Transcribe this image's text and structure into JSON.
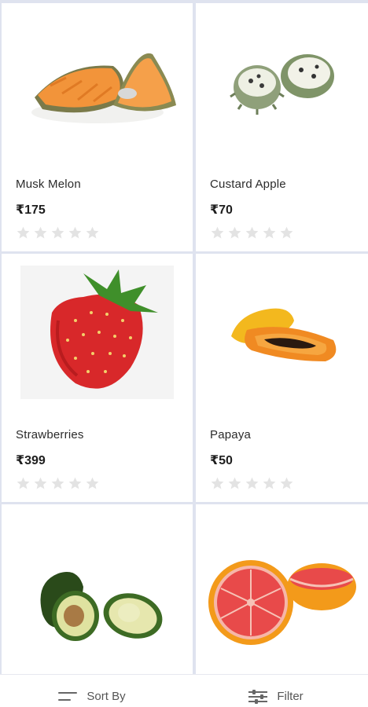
{
  "products": [
    {
      "name": "Musk Melon",
      "price": "₹175",
      "rating": 0,
      "image": "musk-melon"
    },
    {
      "name": "Custard Apple",
      "price": "₹70",
      "rating": 0,
      "image": "custard-apple"
    },
    {
      "name": "Strawberries",
      "price": "₹399",
      "rating": 0,
      "image": "strawberry"
    },
    {
      "name": "Papaya",
      "price": "₹50",
      "rating": 0,
      "image": "papaya"
    },
    {
      "name": "",
      "price": "",
      "rating": 0,
      "image": "avocado"
    },
    {
      "name": "",
      "price": "",
      "rating": 0,
      "image": "grapefruit"
    }
  ],
  "bottom_bar": {
    "sort_label": "Sort By",
    "filter_label": "Filter",
    "sort_icon": "sort-lines-icon",
    "filter_icon": "sliders-icon"
  },
  "colors": {
    "star_empty": "#e3e3e3",
    "divider": "#dfe3ef"
  }
}
